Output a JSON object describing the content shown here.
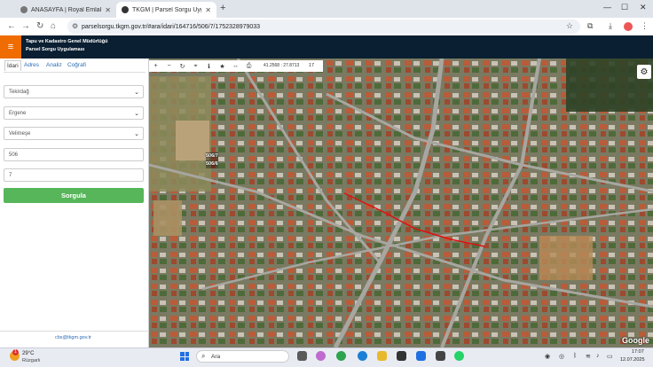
{
  "browser": {
    "tabs": [
      {
        "title": "ANASAYFA | Royal Emlak | Çor..."
      },
      {
        "title": "TKGM | Parsel Sorgu Uygulaması"
      }
    ],
    "url": "parselsorgu.tkgm.gov.tr/#ara/idari/164716/506/7/1752328979033"
  },
  "site": {
    "org_line1": "Tapu ve Kadastro Genel Müdürlüğü",
    "org_line2": "Parsel Sorgu Uygulaması"
  },
  "panel": {
    "tabs": [
      "İdari",
      "Adres",
      "Analiz",
      "Coğrafi"
    ],
    "active_tab": "İdari",
    "province": "Tekirdağ",
    "district": "Ergene",
    "neighborhood": "Velimeşe",
    "block": "506",
    "parcel": "7",
    "submit_label": "Sorgula",
    "contact_email": "cbs@tkgm.gov.tr"
  },
  "map": {
    "coords": "41.2568 : 27.8713",
    "zoom": "17",
    "parcel_label_top": "506/7",
    "parcel_label_bottom": "506/6",
    "attribution": "Google"
  },
  "taskbar": {
    "temperature": "29°C",
    "weather": "Rüzgarlı",
    "weather_badge": "1",
    "search_placeholder": "Ara",
    "time": "17:07",
    "date": "12.07.2025"
  },
  "colors": {
    "header_bg": "#0a1f31",
    "accent": "#ef6c00",
    "submit": "#57b65a",
    "parcel_line": "#e01010"
  }
}
